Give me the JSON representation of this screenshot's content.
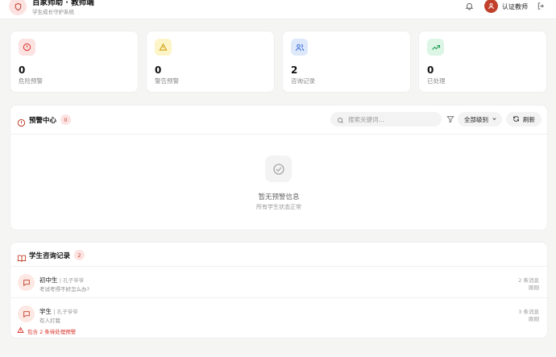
{
  "header": {
    "title": "百家师助 · 教师端",
    "subtitle": "学生成长守护系统",
    "user_name": "认证教师",
    "icons": {
      "brand": "shield-icon",
      "bell": "bell-icon",
      "avatar": "user-icon",
      "logout": "logout-icon"
    }
  },
  "stats": [
    {
      "value": "0",
      "label": "危险预警",
      "icon": "alert-circle-icon",
      "color": "#d9342b",
      "bg": "#fde2e2"
    },
    {
      "value": "0",
      "label": "警告预警",
      "icon": "warning-triangle-icon",
      "color": "#c99a06",
      "bg": "#fdf5c8"
    },
    {
      "value": "2",
      "label": "咨询记录",
      "icon": "users-icon",
      "color": "#3b6fd9",
      "bg": "#dde8fb"
    },
    {
      "value": "0",
      "label": "已处理",
      "icon": "trending-up-icon",
      "color": "#1f9d55",
      "bg": "#dcf5e5"
    }
  ],
  "alerts": {
    "title": "预警中心",
    "count": "0",
    "search_placeholder": "搜索关键词...",
    "level_select": "全部级别",
    "refresh_label": "刷新",
    "empty_title": "暂无预警信息",
    "empty_subtitle": "所有学生状态正常"
  },
  "records": {
    "title": "学生咨询记录",
    "count": "2",
    "items": [
      {
        "name": "初中生",
        "who": "| 孔子爷爷",
        "preview": "考试考得不好怎么办?",
        "count": "2 条消息",
        "time": "刚刚"
      },
      {
        "name": "学生",
        "who": "| 孔子爷爷",
        "preview": "有人打我",
        "count": "3 条消息",
        "time": "刚刚",
        "warning": "包含 2 条待处理预警"
      }
    ]
  },
  "colors": {
    "accent": "#c2412d",
    "danger": "#d9342b",
    "page_bg": "#f5f5f4"
  }
}
